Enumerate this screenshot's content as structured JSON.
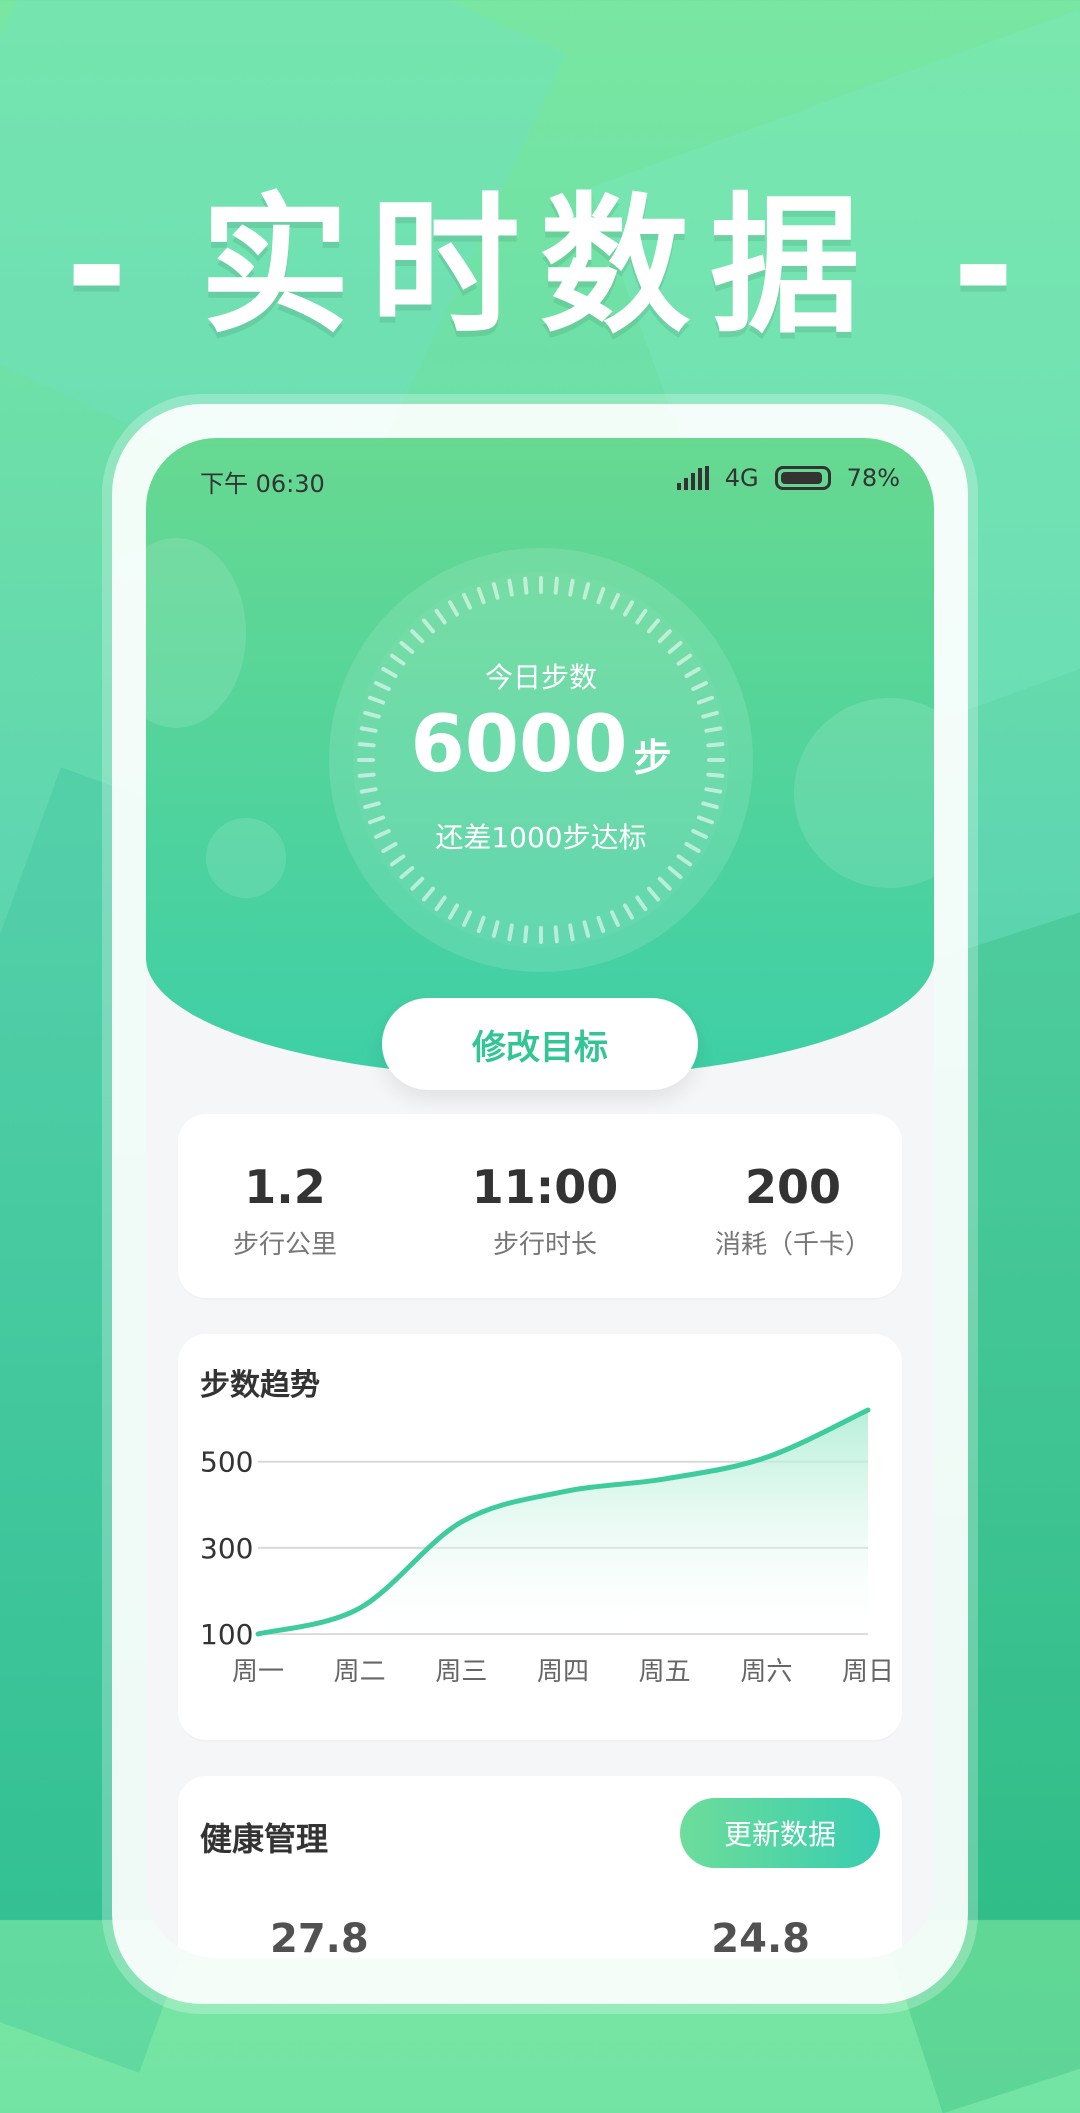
{
  "headline": {
    "left_dash": "-",
    "text": "实时数据",
    "right_dash": "-"
  },
  "status": {
    "time": "下午 06:30",
    "network": "4G",
    "battery": "78%"
  },
  "ring": {
    "title": "今日步数",
    "value": "6000",
    "unit": "步",
    "subtitle": "还差1000步达标"
  },
  "goal_button": {
    "label": "修改目标"
  },
  "stats": [
    {
      "value": "1.2",
      "label": "步行公里"
    },
    {
      "value": "11:00",
      "label": "步行时长"
    },
    {
      "value": "200",
      "label": "消耗（千卡）"
    }
  ],
  "trend": {
    "title": "步数趋势",
    "chart_data": {
      "type": "area",
      "categories": [
        "周一",
        "周二",
        "周三",
        "周四",
        "周五",
        "周六",
        "周日"
      ],
      "values": [
        100,
        160,
        360,
        430,
        460,
        510,
        620
      ],
      "ylabel": "",
      "xlabel": "",
      "yticks": [
        100,
        300,
        500
      ],
      "ylim": [
        100,
        620
      ]
    },
    "colors": {
      "line": "#3fcc9c",
      "fill_top": "#a9ecd2",
      "fill_bottom": "#ffffff"
    }
  },
  "health": {
    "title": "健康管理",
    "update_label": "更新数据",
    "peek_left": "27.8",
    "peek_right": "24.8"
  }
}
